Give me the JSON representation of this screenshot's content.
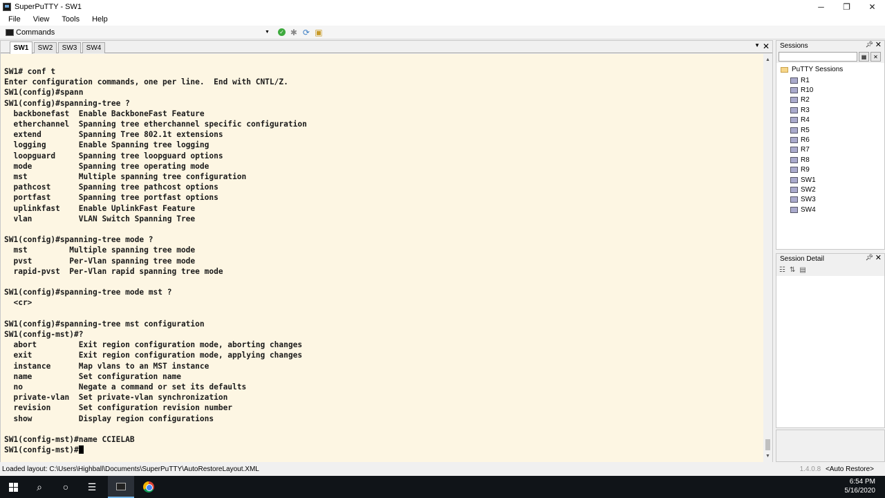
{
  "window": {
    "title": "SuperPuTTY - SW1",
    "controls": [
      "─",
      "❐",
      "✕"
    ]
  },
  "menu": [
    "File",
    "View",
    "Tools",
    "Help"
  ],
  "commandbar": {
    "label": "Commands"
  },
  "tabs": [
    {
      "label": "SW1",
      "active": true
    },
    {
      "label": "SW2",
      "active": false
    },
    {
      "label": "SW3",
      "active": false
    },
    {
      "label": "SW4",
      "active": false
    }
  ],
  "terminal": {
    "lines": [
      "SW1# conf t",
      "Enter configuration commands, one per line.  End with CNTL/Z.",
      "SW1(config)#spann",
      "SW1(config)#spanning-tree ?",
      "  backbonefast  Enable BackboneFast Feature",
      "  etherchannel  Spanning tree etherchannel specific configuration",
      "  extend        Spanning Tree 802.1t extensions",
      "  logging       Enable Spanning tree logging",
      "  loopguard     Spanning tree loopguard options",
      "  mode          Spanning tree operating mode",
      "  mst           Multiple spanning tree configuration",
      "  pathcost      Spanning tree pathcost options",
      "  portfast      Spanning tree portfast options",
      "  uplinkfast    Enable UplinkFast Feature",
      "  vlan          VLAN Switch Spanning Tree",
      "",
      "SW1(config)#spanning-tree mode ?",
      "  mst         Multiple spanning tree mode",
      "  pvst        Per-Vlan spanning tree mode",
      "  rapid-pvst  Per-Vlan rapid spanning tree mode",
      "",
      "SW1(config)#spanning-tree mode mst ?",
      "  <cr>",
      "",
      "SW1(config)#spanning-tree mst configuration",
      "SW1(config-mst)#?",
      "  abort         Exit region configuration mode, aborting changes",
      "  exit          Exit region configuration mode, applying changes",
      "  instance      Map vlans to an MST instance",
      "  name          Set configuration name",
      "  no            Negate a command or set its defaults",
      "  private-vlan  Set private-vlan synchronization",
      "  revision      Set configuration revision number",
      "  show          Display region configurations",
      "",
      "SW1(config-mst)#name CCIELAB",
      "SW1(config-mst)#"
    ]
  },
  "sessions_panel": {
    "title": "Sessions",
    "root": "PuTTY Sessions",
    "items": [
      "R1",
      "R10",
      "R2",
      "R3",
      "R4",
      "R5",
      "R6",
      "R7",
      "R8",
      "R9",
      "SW1",
      "SW2",
      "SW3",
      "SW4"
    ]
  },
  "detail_panel": {
    "title": "Session Detail"
  },
  "status": {
    "left": "Loaded layout: C:\\Users\\Highball\\Documents\\SuperPuTTY\\AutoRestoreLayout.XML",
    "version": "1.4.0.8",
    "mode": "<Auto Restore>"
  },
  "clock": {
    "time": "6:54 PM",
    "date": "5/16/2020"
  },
  "colors": {
    "terminal_bg": "#fdf6e3",
    "taskbar": "#101418"
  }
}
